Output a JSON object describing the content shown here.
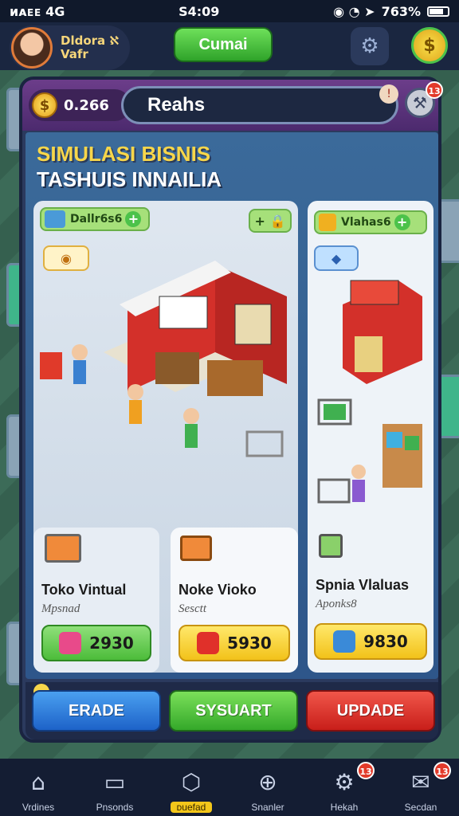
{
  "status": {
    "carrier": "ᴎᴀᴇᴇ 4G",
    "time": "S4:09",
    "battery": "763%"
  },
  "topbar": {
    "name_line1": "Dldora ℵ",
    "name_line2": "Vafr",
    "main_button": "Cumai"
  },
  "header": {
    "coins": "0.266",
    "search_text": "Reahs",
    "wrench_badge": "13",
    "search_badge": "!"
  },
  "titles": {
    "line1": "SIMULASI BISNIS",
    "line2": "TASHUIS INNAILIA"
  },
  "left_card": {
    "tag": "Dallr6s6",
    "tag_plus": "+"
  },
  "right_card": {
    "tag": "Vlahas6",
    "tag_plus": "+"
  },
  "items": [
    {
      "name": "Toko Vintual",
      "sub": "Mpsnad",
      "price": "2930",
      "style": "green"
    },
    {
      "name": "Noke Vioko",
      "sub": "Sesctt",
      "price": "5930",
      "style": "yellow"
    },
    {
      "name": "Spnia Vlaluas",
      "sub": "Aponks8",
      "price": "9830",
      "style": "yellow"
    }
  ],
  "actions": {
    "blue": "ERADE",
    "green": "SYSUART",
    "red": "UPDADE"
  },
  "nav": [
    {
      "label": "Vrdines",
      "icon": "home-icon",
      "glyph": "⌂"
    },
    {
      "label": "Pnsonds",
      "icon": "device-icon",
      "glyph": "▭"
    },
    {
      "label": "ᴅuefad",
      "icon": "hexagon-icon",
      "glyph": "⬡"
    },
    {
      "label": "Snanler",
      "icon": "compass-icon",
      "glyph": "⊕"
    },
    {
      "label": "Hekah",
      "icon": "gear-icon",
      "glyph": "⚙",
      "badge": "13"
    },
    {
      "label": "Secdan",
      "icon": "mail-icon",
      "glyph": "✉",
      "badge": "13"
    }
  ],
  "colors": {
    "accent_yellow": "#f7d64a",
    "panel": "#2b3a5e",
    "green": "#4cc24a",
    "red": "#e23a2a"
  }
}
